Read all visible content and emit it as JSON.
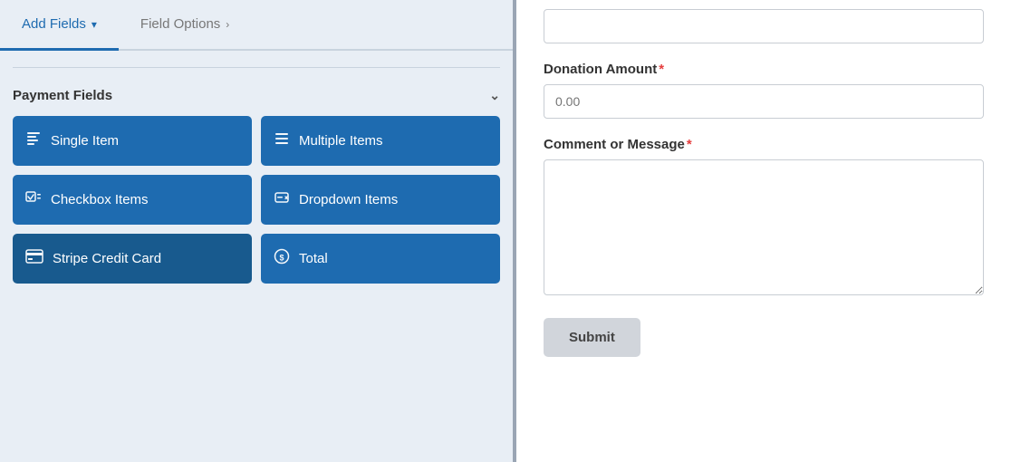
{
  "tabs": {
    "add_fields_label": "Add Fields",
    "add_fields_chevron": "▾",
    "field_options_label": "Field Options",
    "field_options_chevron": "›"
  },
  "payment_fields": {
    "section_label": "Payment Fields",
    "chevron": "⌄",
    "buttons": [
      {
        "id": "single-item",
        "label": "Single Item",
        "icon": "📄"
      },
      {
        "id": "multiple-items",
        "label": "Multiple Items",
        "icon": "☰"
      },
      {
        "id": "checkbox-items",
        "label": "Checkbox Items",
        "icon": "☑"
      },
      {
        "id": "dropdown-items",
        "label": "Dropdown Items",
        "icon": "⊟"
      },
      {
        "id": "stripe-credit-card",
        "label": "Stripe Credit Card",
        "icon": "💳"
      },
      {
        "id": "total",
        "label": "Total",
        "icon": "💲"
      }
    ]
  },
  "form": {
    "top_input_placeholder": "",
    "donation_amount_label": "Donation Amount",
    "donation_amount_placeholder": "0.00",
    "comment_label": "Comment or Message",
    "comment_placeholder": "",
    "submit_label": "Submit"
  },
  "icons": {
    "single_item": "🗒",
    "multiple_items": "≡",
    "checkbox": "☑",
    "dropdown": "⊟",
    "stripe": "💳",
    "total": "💲"
  }
}
